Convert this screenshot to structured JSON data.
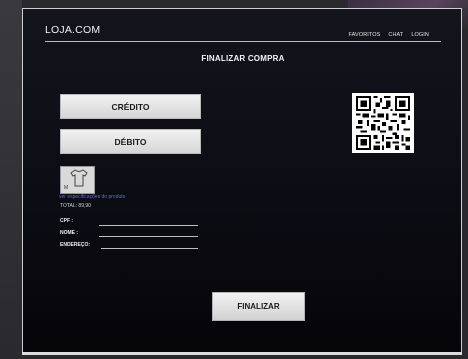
{
  "header": {
    "logo": "LOJA.COM",
    "nav": [
      "FAVORITOS",
      "CHAT",
      "LOGIN"
    ]
  },
  "page": {
    "title": "FINALIZAR COMPRA"
  },
  "payment": {
    "credit_label": "CRÉDITO",
    "debit_label": "DÉBITO"
  },
  "product": {
    "size": "M",
    "link_text": "ver especificações do produto",
    "total": "TOTAL: 89,90"
  },
  "form": {
    "cpf_label": "CPF :",
    "nome_label": "NOME :",
    "endereco_label": "ENDEREÇO:"
  },
  "actions": {
    "finalize_label": "FINALIZAR"
  },
  "icons": {
    "product": "tshirt-icon",
    "qr": "qr-code-icon"
  },
  "colors": {
    "background": "#0c0c14",
    "button": "#e0e0e0",
    "link": "#5c6fd6",
    "text": "#f0f0f0"
  }
}
